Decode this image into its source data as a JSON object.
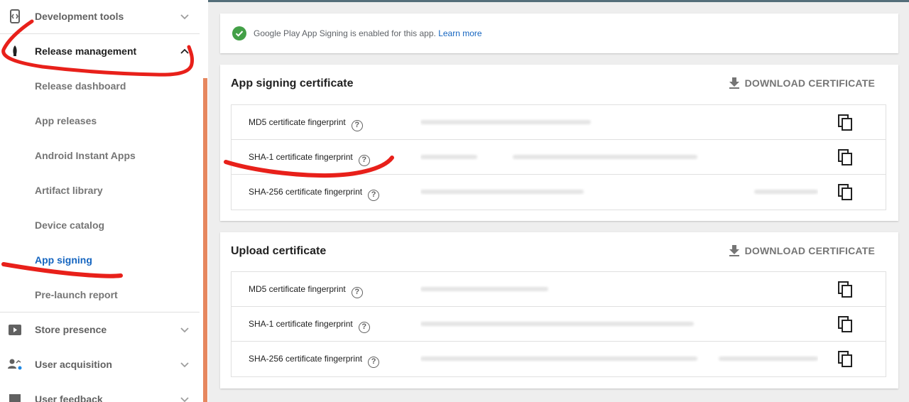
{
  "sidebar": {
    "sections": [
      {
        "label": "Development tools",
        "icon": "code-brackets-icon"
      },
      {
        "label": "Release management",
        "icon": "rocket-icon",
        "expanded": true
      },
      {
        "label": "Store presence",
        "icon": "play-store-icon"
      },
      {
        "label": "User acquisition",
        "icon": "user-acquisition-icon"
      },
      {
        "label": "User feedback",
        "icon": "feedback-icon"
      }
    ],
    "sub_items": [
      {
        "label": "Release dashboard"
      },
      {
        "label": "App releases"
      },
      {
        "label": "Android Instant Apps"
      },
      {
        "label": "Artifact library"
      },
      {
        "label": "Device catalog"
      },
      {
        "label": "App signing",
        "selected": true
      },
      {
        "label": "Pre-launch report"
      }
    ]
  },
  "notice": {
    "text": "Google Play App Signing is enabled for this app.",
    "link": "Learn more"
  },
  "app_signing_card": {
    "title": "App signing certificate",
    "download_label": "DOWNLOAD CERTIFICATE",
    "rows": [
      {
        "label": "MD5 certificate fingerprint"
      },
      {
        "label": "SHA-1 certificate fingerprint"
      },
      {
        "label": "SHA-256 certificate fingerprint"
      }
    ]
  },
  "upload_card": {
    "title": "Upload certificate",
    "download_label": "DOWNLOAD CERTIFICATE",
    "rows": [
      {
        "label": "MD5 certificate fingerprint"
      },
      {
        "label": "SHA-1 certificate fingerprint"
      },
      {
        "label": "SHA-256 certificate fingerprint"
      }
    ]
  },
  "colors": {
    "accent_blue": "#1565c0",
    "success_green": "#43a047",
    "annotation_red": "#e8201a",
    "scroll_orange": "#e6875f"
  }
}
